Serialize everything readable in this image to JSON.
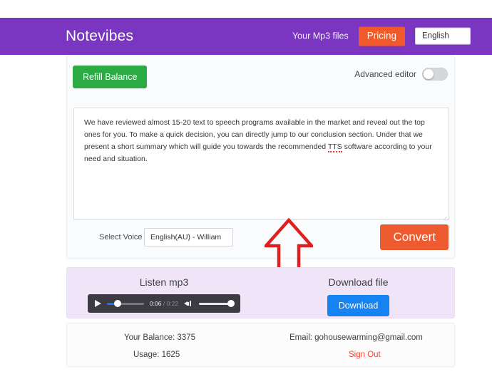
{
  "header": {
    "brand": "Notevibes",
    "nav_link": "Your Mp3 files",
    "pricing_button": "Pricing",
    "language_value": "English"
  },
  "editor": {
    "refill_button": "Refill Balance",
    "advanced_editor_label": "Advanced editor",
    "advanced_editor_state": "off",
    "textarea_text_part1": "We have reviewed almost 15-20 text to speech programs available in the market and reveal out the top ones for you. To make a quick decision, you can directly jump to our conclusion section. Under that we present a short summary which will guide you towards the recommended ",
    "textarea_text_spell": "TTS",
    "textarea_text_part2": " software according to your need and situation.",
    "annotation": "red-up-arrow",
    "select_voice_label": "Select Voice",
    "voice_value": "English(AU) - William",
    "convert_button": "Convert"
  },
  "media": {
    "listen_title": "Listen mp3",
    "current_time": "0:06",
    "separator": " / ",
    "duration": "0:22",
    "download_title": "Download file",
    "download_button": "Download"
  },
  "footer": {
    "balance": "Your Balance: 3375",
    "usage": "Usage: 1625",
    "email": "Email: gohousewarming@gmail.com",
    "sign_out": "Sign Out"
  },
  "colors": {
    "header_purple": "#7a35c1",
    "pricing_orange": "#f05a2a",
    "refill_green": "#2cab45",
    "convert_orange": "#ef5b30",
    "download_blue": "#1683f2",
    "signout_red": "#ef4136",
    "media_panel_lavender": "#f0e4f8",
    "annotation_red": "#e02020"
  }
}
